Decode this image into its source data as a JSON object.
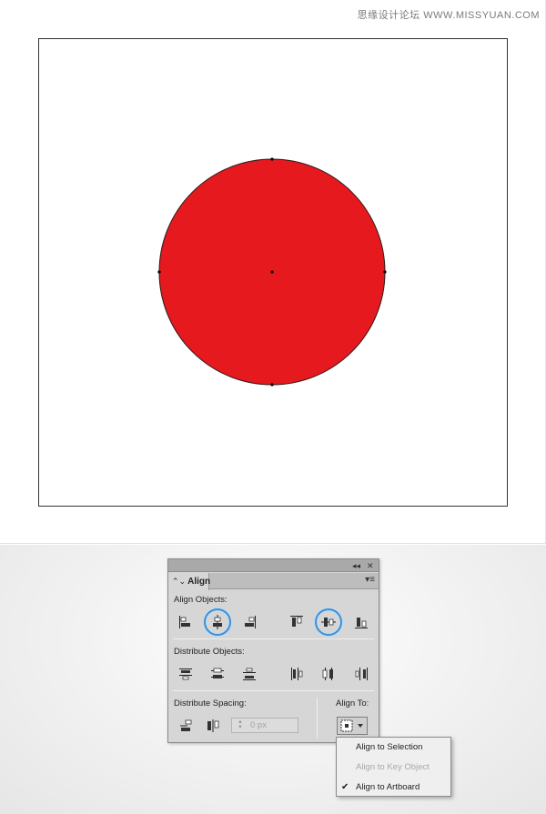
{
  "watermark": "思缘设计论坛 WWW.MISSYUAN.COM",
  "circle": {
    "fill": "#e5191e",
    "stroke": "#2b1a1a"
  },
  "panel": {
    "tab_label": "Align",
    "tab_arrows": "⌃⌄",
    "collapse_icon": "◂◂",
    "close_icon": "✕",
    "menu_icon": "▾≡",
    "sections": {
      "align_objects": "Align Objects:",
      "distribute_objects": "Distribute Objects:",
      "distribute_spacing": "Distribute Spacing:",
      "align_to": "Align To:"
    },
    "spacing": {
      "value": "0 px"
    },
    "highlight_color": "#3d8fd6"
  },
  "dropdown": {
    "items": [
      {
        "label": "Align to Selection",
        "enabled": true,
        "checked": false
      },
      {
        "label": "Align to Key Object",
        "enabled": false,
        "checked": false
      },
      {
        "label": "Align to Artboard",
        "enabled": true,
        "checked": true
      }
    ],
    "check_mark": "✔"
  }
}
